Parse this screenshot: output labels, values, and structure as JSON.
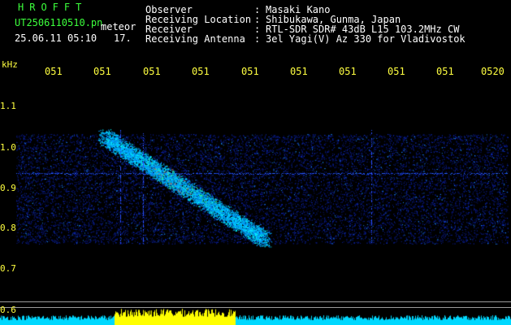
{
  "header": {
    "brand": "HROFFT",
    "filename": "UT2506110510.pn",
    "event_type": "meteor",
    "datetime": "25.06.11 05:10",
    "counter": "17.",
    "fields": [
      {
        "label": "Observer",
        "sep": ":",
        "value": "Masaki Kano"
      },
      {
        "label": "Receiving Location",
        "sep": ":",
        "value": "Shibukawa, Gunma, Japan"
      },
      {
        "label": "Receiver",
        "sep": ":",
        "value": "RTL-SDR SDR# 43dB L15 103.2MHz CW"
      },
      {
        "label": "Receiving Antenna",
        "sep": ":",
        "value": "3el Yagi(V) Az 330 for Vladivostok"
      }
    ]
  },
  "axis": {
    "unit": "kHz",
    "time_ticks": [
      "051",
      "051",
      "051",
      "051",
      "051",
      "051",
      "051",
      "051",
      "051",
      "0520"
    ],
    "freq_ticks": [
      "1.1",
      "1.0",
      "0.9",
      "0.8",
      "0.7",
      "0.6"
    ]
  },
  "colors": {
    "header_green": "#3cff3c",
    "label_white": "#ffffff",
    "axis_yellow": "#ffff40",
    "signal_cyan": "#00e0ff",
    "signal_yellow": "#ffff00"
  }
}
